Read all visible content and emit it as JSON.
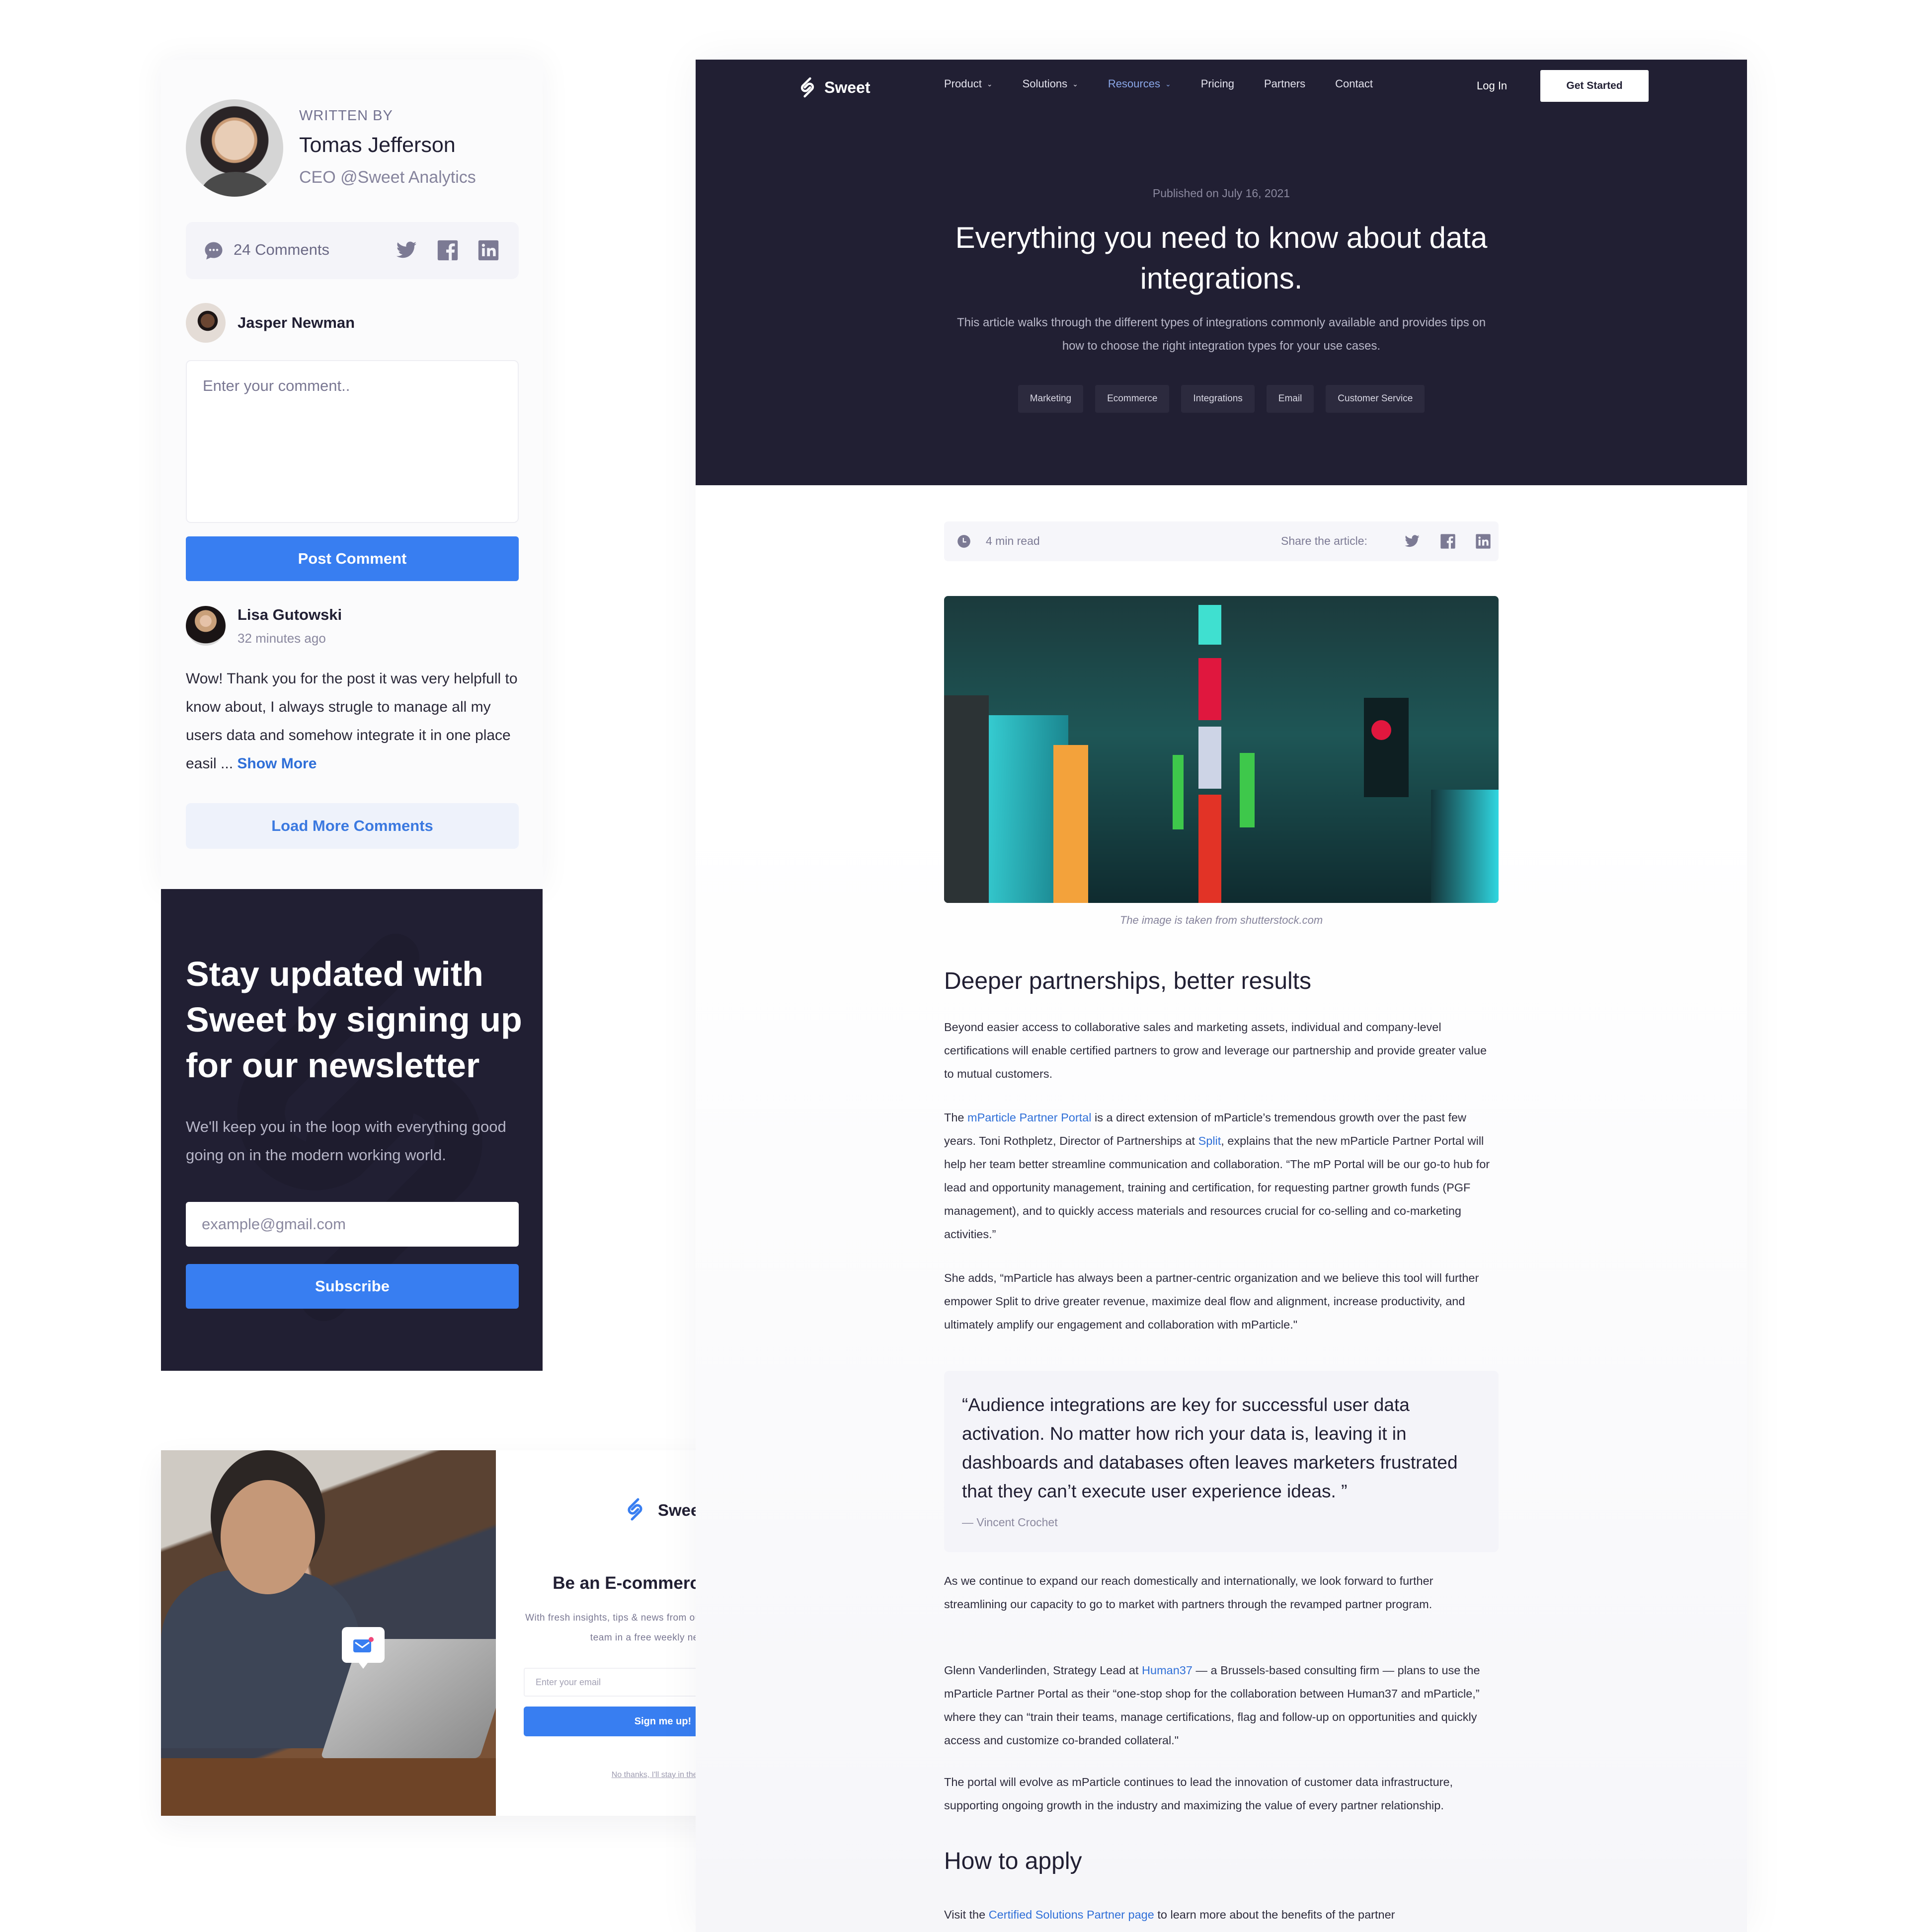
{
  "author_card": {
    "written_by_label": "WRITTEN BY",
    "author_name": "Tomas Jefferson",
    "author_title": "CEO @Sweet Analytics",
    "comments_count": "24 Comments",
    "social_icons": [
      "twitter-icon",
      "facebook-icon",
      "linkedin-icon"
    ]
  },
  "comment_form": {
    "current_user": "Jasper Newman",
    "placeholder": "Enter your comment..",
    "value": "",
    "submit_label": "Post Comment"
  },
  "comments": [
    {
      "author": "Lisa Gutowski",
      "time": "32 minutes ago",
      "text": "Wow! Thank you for the post it was very helpfull to know about, I always strugle to manage all my users data and somehow integrate it in one place easil ... ",
      "show_more_label": "Show More"
    }
  ],
  "load_more_label": "Load More Comments",
  "newsletter": {
    "title": "Stay updated with Sweet by signing up for our newsletter",
    "subtitle": "We'll keep you in the loop with everything good going on in the modern working world.",
    "email_placeholder": "example@gmail.com",
    "email_value": "",
    "subscribe_label": "Subscribe"
  },
  "popup": {
    "brand": "Sweet",
    "title": "Be an E-commerce Expert!",
    "subtitle": "With fresh insights, tips & news from our ecommerce business team in a free weekly newsletter.",
    "email_placeholder": "Enter your email",
    "email_value": "",
    "cta_label": "Sign me up!",
    "dismiss_label": "No thanks, I'll stay in the dark",
    "close_icon": "×"
  },
  "nav": {
    "brand": "Sweet",
    "links": [
      {
        "label": "Product",
        "dropdown": true,
        "active": false
      },
      {
        "label": "Solutions",
        "dropdown": true,
        "active": false
      },
      {
        "label": "Resources",
        "dropdown": true,
        "active": true
      },
      {
        "label": "Pricing",
        "dropdown": false,
        "active": false
      },
      {
        "label": "Partners",
        "dropdown": false,
        "active": false
      },
      {
        "label": "Contact",
        "dropdown": false,
        "active": false
      }
    ],
    "login_label": "Log In",
    "cta_label": "Get Started"
  },
  "hero": {
    "published": "Published on July 16, 2021",
    "title": "Everything you need to know about data integrations.",
    "lede": "This article walks through the different types of integrations commonly available and provides tips on how to choose the right integration types for your use cases.",
    "tags": [
      "Marketing",
      "Ecommerce",
      "Integrations",
      "Email",
      "Customer Service"
    ]
  },
  "meta": {
    "read_time": "4 min read",
    "share_label": "Share the article:"
  },
  "image_caption": "The image is taken from shutterstock.com",
  "article": {
    "h2_1": "Deeper partnerships, better results",
    "p1": "Beyond easier access to collaborative sales and marketing assets, individual and company-level certifications will enable certified partners to grow and leverage our partnership and provide greater value to mutual customers.",
    "p2_pre": "The ",
    "p2_link1": "mParticle Partner Portal",
    "p2_mid": " is a direct extension of mParticle’s tremendous growth over the past few years. Toni Rothpletz, Director of Partnerships at ",
    "p2_link2": "Split",
    "p2_post": ", explains that the new mParticle Partner Portal will help her team better streamline communication and collaboration. “The mP Portal will be our go-to hub for lead and opportunity management, training and certification, for requesting partner growth funds (PGF management), and to quickly access materials and resources crucial for co-selling and co-marketing activities.”",
    "p3": "She adds, “mParticle has always been a partner-centric organization and we believe this tool will further empower Split to drive greater revenue, maximize deal flow and alignment, increase productivity, and ultimately amplify our engagement and collaboration with mParticle.\"",
    "quote": "“Audience integrations are key for successful user data activation. No matter how rich your data is, leaving it in dashboards and databases often leaves marketers frustrated that they can’t execute user experience ideas. ”",
    "quote_author": "— Vincent Crochet",
    "p4": "As we continue to expand our reach domestically and internationally, we look forward to further streamlining our capacity to go to market with partners through the revamped partner program.",
    "p5_pre": "Glenn Vanderlinden, Strategy Lead at ",
    "p5_link": "Human37",
    "p5_post": " — a Brussels-based consulting firm — plans to use the mParticle Partner Portal as their “one-stop shop for the collaboration between Human37 and mParticle,” where they can “train their teams, manage certifications, flag and follow-up on opportunities and quickly access and customize co-branded collateral.\"",
    "p6": "The portal will evolve as mParticle continues to lead the innovation of customer data infrastructure, supporting ongoing growth in the industry and maximizing the value of every partner relationship.",
    "h2_2": "How to apply",
    "p7_pre": "Visit the ",
    "p7_link": "Certified Solutions Partner page",
    "p7_post": " to learn more about the benefits of the partner"
  },
  "colors": {
    "dark": "#211f33",
    "accent_blue": "#387ef1",
    "link_blue": "#2f6fd8",
    "muted": "#7c7a94"
  }
}
